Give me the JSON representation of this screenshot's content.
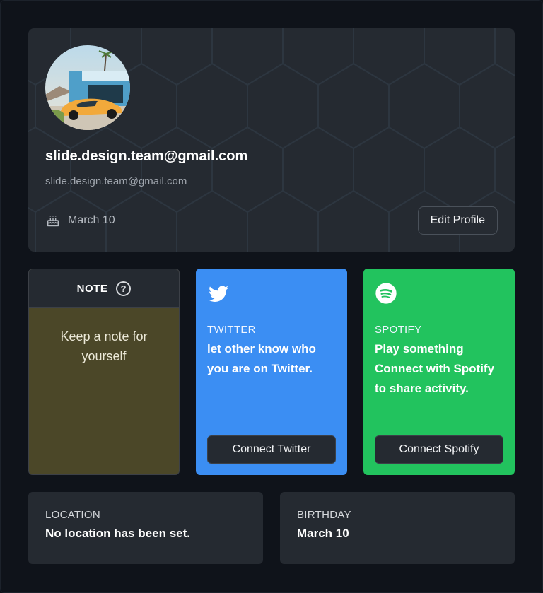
{
  "profile": {
    "display_name": "slide.design.team@gmail.com",
    "email": "slide.design.team@gmail.com",
    "birthday": "March 10",
    "edit_label": "Edit Profile"
  },
  "note": {
    "title": "NOTE",
    "help_glyph": "?",
    "body": "Keep a note for yourself",
    "bg_color": "#4b4728"
  },
  "twitter": {
    "icon": "twitter-bird-icon",
    "label": "TWITTER",
    "description": "let other know who you are on Twitter.",
    "button": "Connect Twitter",
    "color": "#3b8ef3"
  },
  "spotify": {
    "icon": "spotify-icon",
    "label": "SPOTIFY",
    "description": "Play something Connect with Spotify to share activity.",
    "button": "Connect Spotify",
    "color": "#22c35e"
  },
  "location": {
    "label": "LOCATION",
    "value": "No location has been set."
  },
  "birthday_info": {
    "label": "BIRTHDAY",
    "value": "March 10"
  }
}
